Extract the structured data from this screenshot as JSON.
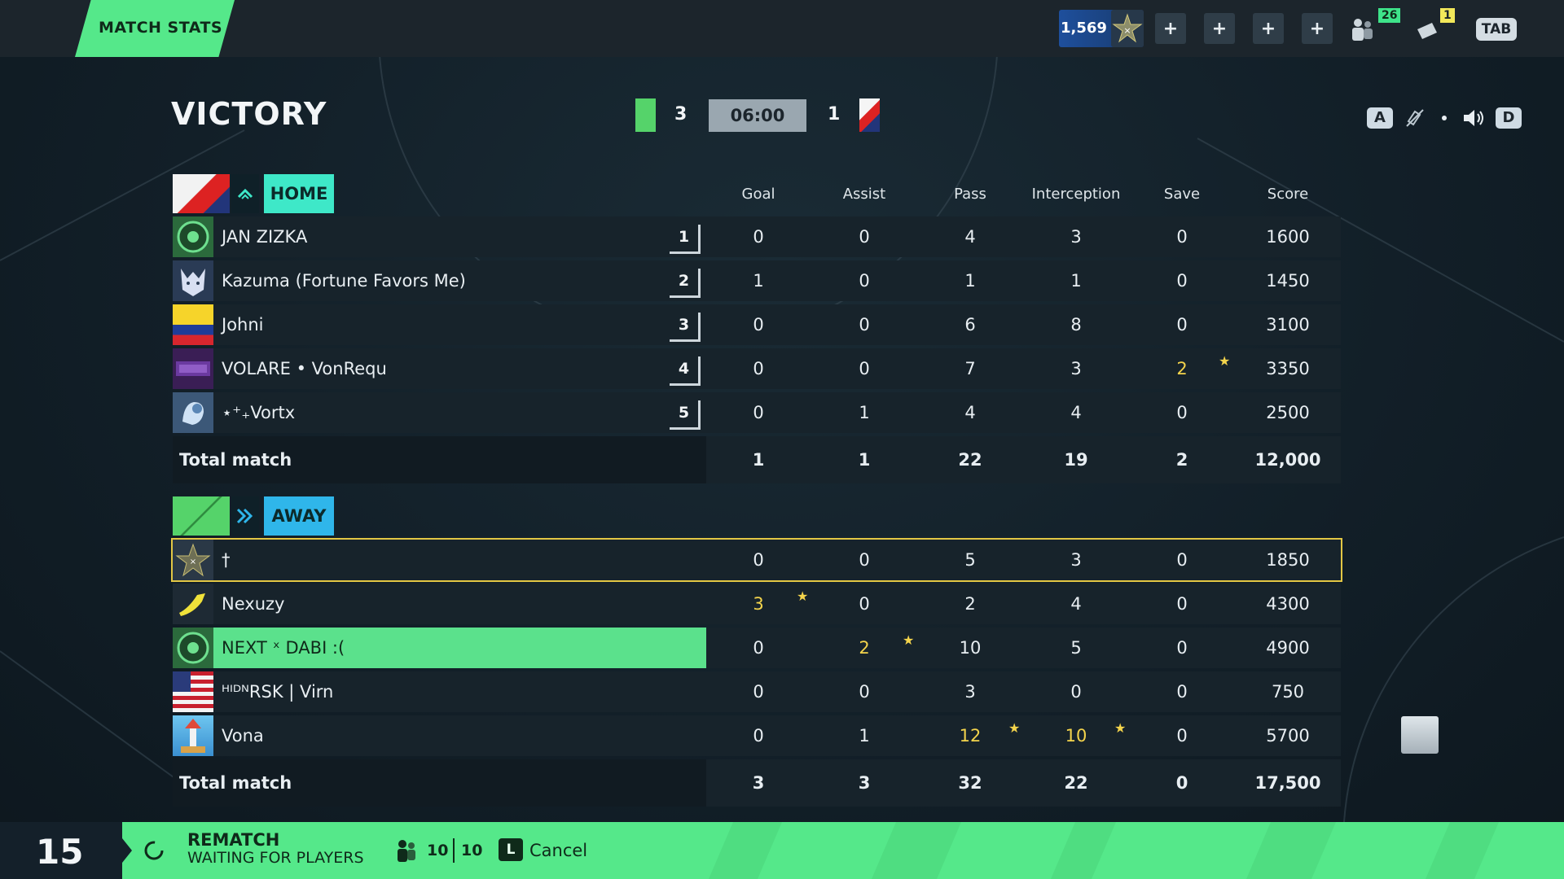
{
  "topbar": {
    "section_label": "MATCH STATS",
    "currency": "1,569",
    "plus_buttons": [
      "+",
      "+",
      "+",
      "+"
    ],
    "friends_count": "26",
    "notifications_count": "1",
    "tab_key": "TAB"
  },
  "header": {
    "result": "VICTORY",
    "home_score": "3",
    "timer": "06:00",
    "away_score": "1",
    "key_left": "A",
    "key_right": "D"
  },
  "columns": [
    "Goal",
    "Assist",
    "Pass",
    "Interception",
    "Save",
    "Score"
  ],
  "home": {
    "label": "HOME",
    "players": [
      {
        "name": "JAN ZIZKA",
        "rank": "1",
        "stats": [
          "0",
          "0",
          "4",
          "3",
          "0",
          "1600"
        ]
      },
      {
        "name": "Kazuma (Fortune Favors Me)",
        "rank": "2",
        "stats": [
          "1",
          "0",
          "1",
          "1",
          "0",
          "1450"
        ]
      },
      {
        "name": "Johni",
        "rank": "3",
        "stats": [
          "0",
          "0",
          "6",
          "8",
          "0",
          "3100"
        ]
      },
      {
        "name": "VOLARE • VonRequ",
        "rank": "4",
        "stats": [
          "0",
          "0",
          "7",
          "3",
          "2",
          "3350"
        ]
      },
      {
        "name": "⋆⁺₊Vortx",
        "rank": "5",
        "stats": [
          "0",
          "1",
          "4",
          "4",
          "0",
          "2500"
        ]
      }
    ],
    "total_label": "Total match",
    "totals": [
      "1",
      "1",
      "22",
      "19",
      "2",
      "12,000"
    ]
  },
  "away": {
    "label": "AWAY",
    "players": [
      {
        "name": "†",
        "stats": [
          "0",
          "0",
          "5",
          "3",
          "0",
          "1850"
        ]
      },
      {
        "name": "Nexuzy",
        "stats": [
          "3",
          "0",
          "2",
          "4",
          "0",
          "4300"
        ]
      },
      {
        "name": "NEXT ˣ DABI :(",
        "stats": [
          "0",
          "2",
          "10",
          "5",
          "0",
          "4900"
        ]
      },
      {
        "name": "ᴴᴵᴰᴺRSK | Virn",
        "stats": [
          "0",
          "0",
          "3",
          "0",
          "0",
          "750"
        ]
      },
      {
        "name": "Vona",
        "stats": [
          "0",
          "1",
          "12",
          "10",
          "0",
          "5700"
        ]
      }
    ],
    "total_label": "Total match",
    "totals": [
      "3",
      "3",
      "32",
      "22",
      "0",
      "17,500"
    ]
  },
  "bottombar": {
    "countdown": "15",
    "rematch": "REMATCH",
    "waiting": "WAITING FOR PLAYERS",
    "players_ready": "10",
    "players_total": "10",
    "cancel_key": "L",
    "cancel_label": "Cancel"
  },
  "colors": {
    "accent_green": "#55e88a",
    "highlight_yellow": "#f4d44c",
    "home_tag": "#3ee8c8",
    "away_tag": "#2fb6ea"
  }
}
